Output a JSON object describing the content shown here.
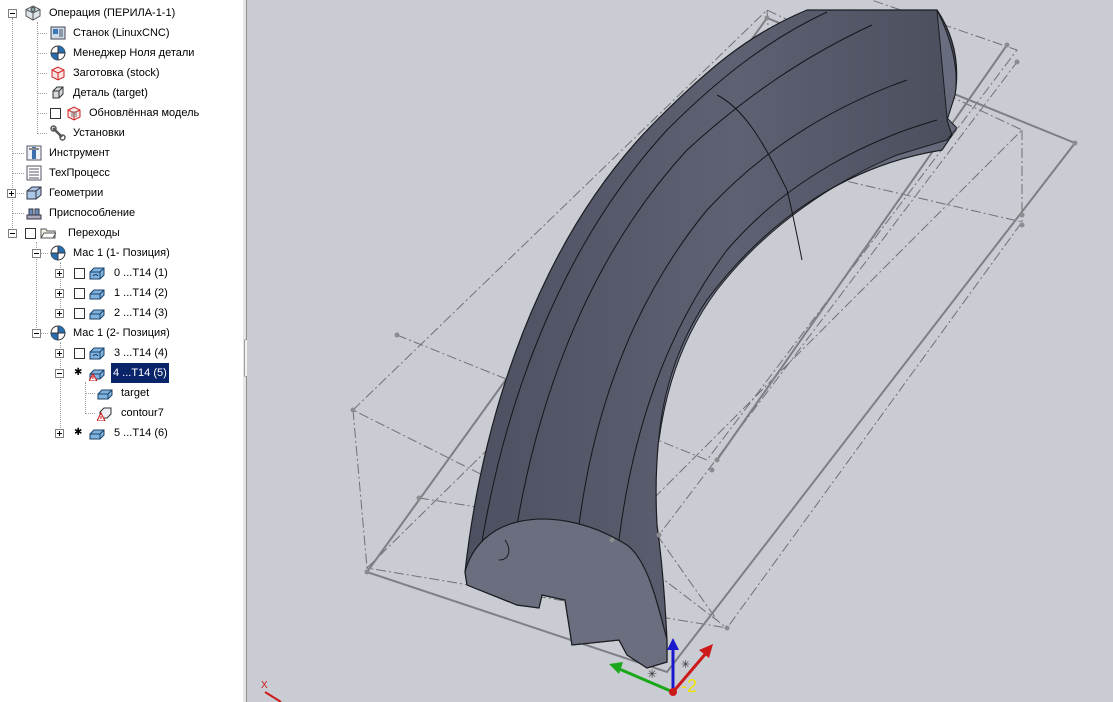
{
  "tree": {
    "items": [
      {
        "label": "Операция (ПЕРИЛА-1-1)",
        "icon": "operation-icon"
      },
      {
        "label": "Станок (LinuxCNC)",
        "icon": "machine-icon"
      },
      {
        "label": "Менеджер Ноля детали",
        "icon": "zero-manager-icon"
      },
      {
        "label": "Заготовка (stock)",
        "icon": "stock-icon"
      },
      {
        "label": "Деталь (target)",
        "icon": "part-icon"
      },
      {
        "label": "Обновлённая модель",
        "icon": "updated-model-icon"
      },
      {
        "label": "Установки",
        "icon": "wrench-icon"
      },
      {
        "label": "Инструмент",
        "icon": "tool-icon"
      },
      {
        "label": "ТехПроцесс",
        "icon": "process-icon"
      },
      {
        "label": "Геометрии",
        "icon": "geometry-icon"
      },
      {
        "label": "Приспособление",
        "icon": "fixture-icon"
      },
      {
        "label": "Переходы",
        "icon": "folder-icon"
      },
      {
        "label": "Мас 1 (1- Позиция)",
        "icon": "position-icon"
      },
      {
        "label": "0 ...T14 (1)",
        "icon": "toolpath-icon"
      },
      {
        "label": "1 ...T14 (2)",
        "icon": "toolpath-icon"
      },
      {
        "label": "2 ...T14 (3)",
        "icon": "toolpath-icon"
      },
      {
        "label": "Мас 1 (2- Позиция)",
        "icon": "position-icon"
      },
      {
        "label": "3 ...T14 (4)",
        "icon": "toolpath-icon"
      },
      {
        "label": "4 ...T14 (5)",
        "icon": "toolpath-warning-icon"
      },
      {
        "label": "target",
        "icon": "target-icon"
      },
      {
        "label": "contour7",
        "icon": "contour-warning-icon"
      },
      {
        "label": "5 ...T14 (6)",
        "icon": "toolpath-icon"
      }
    ]
  },
  "viewport": {
    "axis_label": "-2",
    "corner_axis_label": "X"
  },
  "colors": {
    "viewport_bg": "#c9ccd3",
    "part": "#565a68",
    "selection": "#0a246a",
    "x_axis": "#cc1a1a",
    "y_axis": "#1aa81a",
    "z_axis": "#1a1acc",
    "label_yellow": "#f2e600"
  }
}
